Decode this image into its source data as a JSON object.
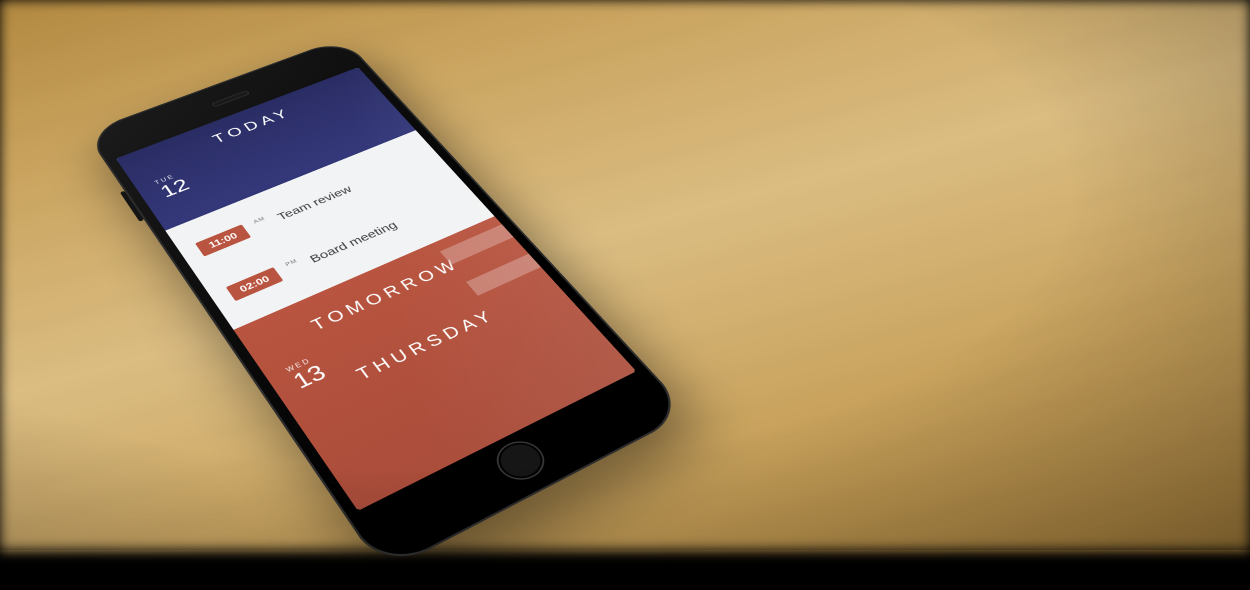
{
  "today": {
    "label": "TODAY",
    "dow": "TUE",
    "dom": "12",
    "events": [
      {
        "time": "11:00",
        "ampm": "AM",
        "title": "Team review"
      },
      {
        "time": "02:00",
        "ampm": "PM",
        "title": "Board meeting"
      }
    ]
  },
  "tomorrow": {
    "label": "TOMORROW",
    "dow": "WED",
    "dom": "13"
  },
  "next_section": {
    "label": "THURSDAY"
  },
  "colors": {
    "navy": "#2a2d64",
    "brick": "#b8543f",
    "cream": "#f2f3f4"
  }
}
